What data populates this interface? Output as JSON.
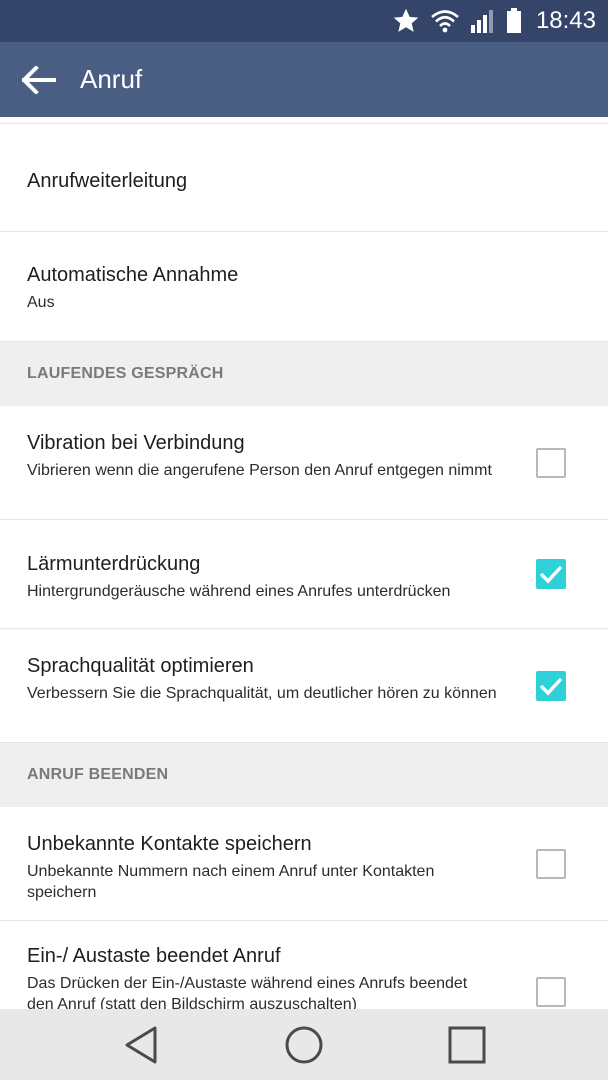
{
  "status_bar": {
    "time": "18:43",
    "icons": [
      "star-icon",
      "wifi-icon",
      "signal-icon",
      "battery-icon"
    ]
  },
  "app_bar": {
    "title": "Anruf",
    "back_icon": "arrow-left-icon"
  },
  "items_top": [
    {
      "title": "Anrufweiterleitung",
      "summary": ""
    },
    {
      "title": "Automatische Annahme",
      "summary": "Aus"
    }
  ],
  "sections": [
    {
      "header": "LAUFENDES GESPRÄCH",
      "items": [
        {
          "title": "Vibration bei Verbindung",
          "summary": "Vibrieren wenn die angerufene Person den Anruf entgegen nimmt",
          "checked": false
        },
        {
          "title": "Lärmunterdrückung",
          "summary": "Hintergrundgeräusche während eines Anrufes unterdrücken",
          "checked": true
        },
        {
          "title": "Sprachqualität optimieren",
          "summary": "Verbessern Sie die Sprachqualität, um deutlicher hören zu können",
          "checked": true
        }
      ]
    },
    {
      "header": "ANRUF BEENDEN",
      "items": [
        {
          "title": "Unbekannte Kontakte speichern",
          "summary": "Unbekannte Nummern nach einem Anruf unter Kontakten speichern",
          "checked": false
        },
        {
          "title": "Ein-/ Austaste beendet Anruf",
          "summary": "Das Drücken der Ein-/Austaste während eines Anrufs beendet den Anruf (statt den Bildschirm auszuschalten)",
          "checked": false
        }
      ]
    }
  ],
  "colors": {
    "status_bar": "#35456a",
    "app_bar": "#4a5d82",
    "checkbox_checked": "#2fd0d8",
    "section_header_bg": "#efefef",
    "section_header_text": "#7a7a7a",
    "nav_bar": "#e8e8e8"
  },
  "nav_bar": {
    "icons": [
      "back-triangle-icon",
      "home-circle-icon",
      "recents-square-icon"
    ]
  }
}
